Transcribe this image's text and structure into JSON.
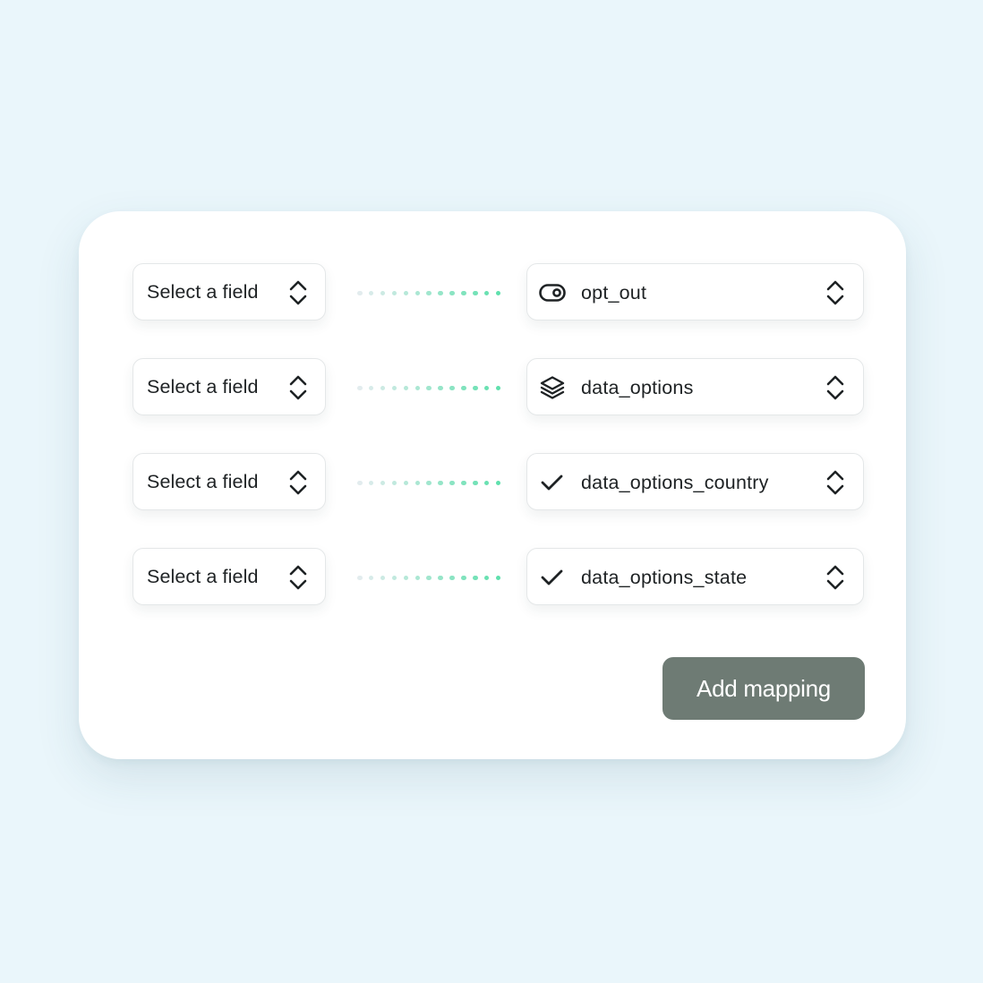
{
  "mappings": [
    {
      "source_label": "Select a field",
      "target_label": "opt_out",
      "target_icon": "toggle-icon"
    },
    {
      "source_label": "Select a field",
      "target_label": "data_options",
      "target_icon": "layers-icon"
    },
    {
      "source_label": "Select a field",
      "target_label": "data_options_country",
      "target_icon": "check-icon"
    },
    {
      "source_label": "Select a field",
      "target_label": "data_options_state",
      "target_icon": "check-icon"
    }
  ],
  "actions": {
    "add_mapping_label": "Add mapping"
  },
  "colors": {
    "background": "#eaf6fb",
    "button": "#6e7b74",
    "connector_start": "#e2ecee",
    "connector_end": "#5fe0ad"
  }
}
